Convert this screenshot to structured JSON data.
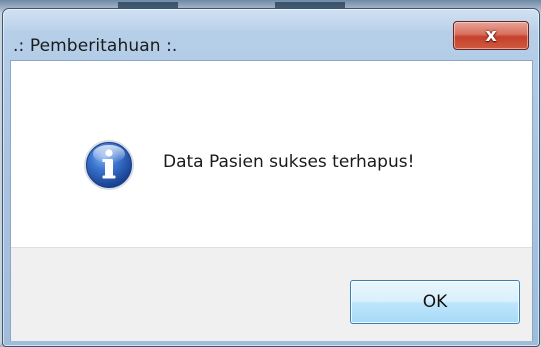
{
  "dialog": {
    "title": ".: Pemberitahuan :.",
    "close_label": "x",
    "message": "Data Pasien sukses terhapus!",
    "ok_label": "OK",
    "icon": "information-icon"
  },
  "colors": {
    "close_button": "#c5412b",
    "ok_button_border": "#3c7fb1",
    "info_icon": "#2c5fb6",
    "title_bar": "#aac5e2"
  }
}
